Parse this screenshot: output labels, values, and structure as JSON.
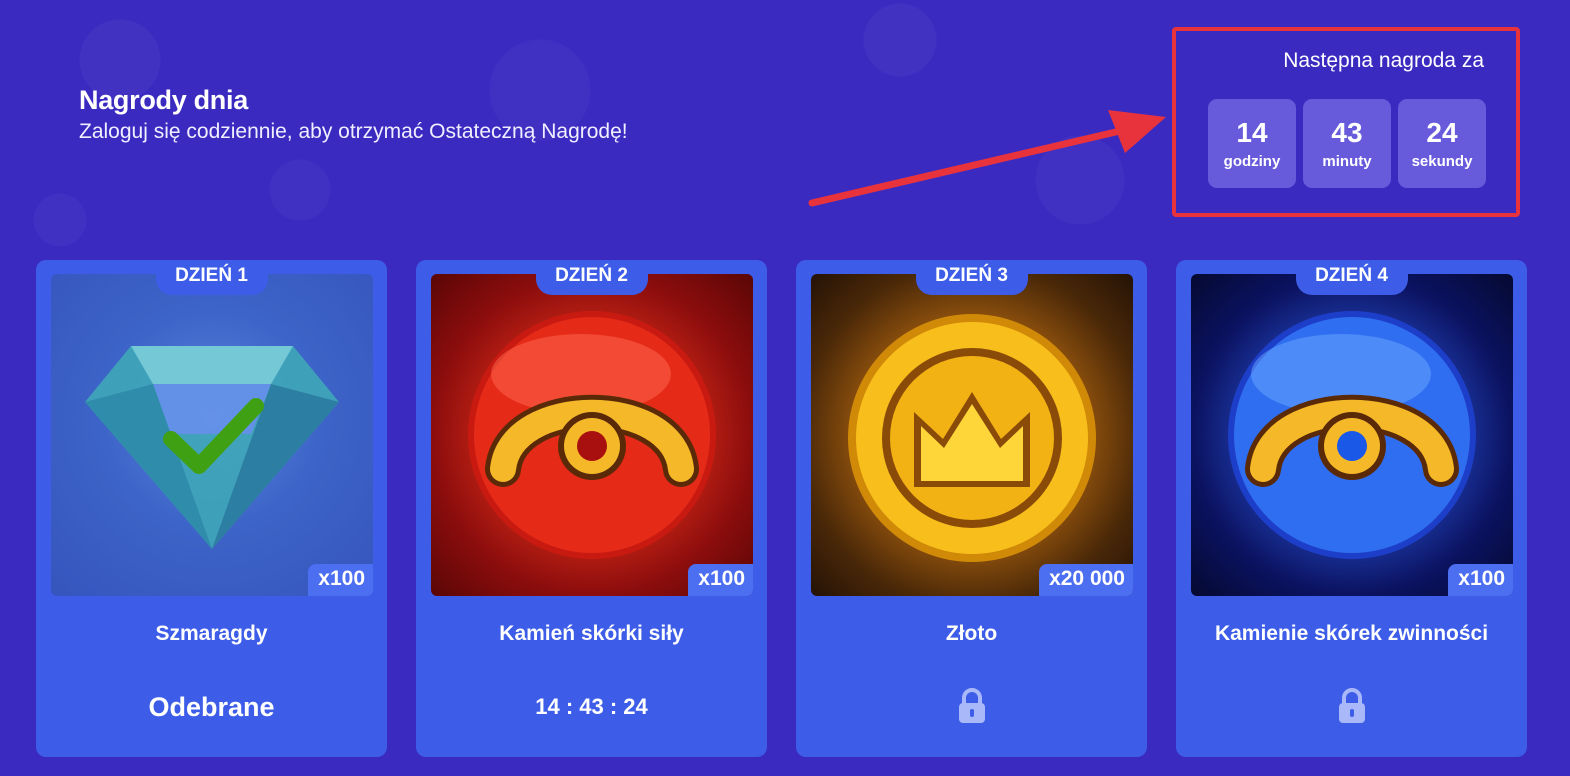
{
  "header": {
    "title": "Nagrody dnia",
    "subtitle": "Zaloguj się codziennie, aby otrzymać Ostateczną Nagrodę!"
  },
  "next_reward": {
    "title": "Następna nagroda za",
    "hours": "14",
    "hours_label": "godziny",
    "minutes": "43",
    "minutes_label": "minuty",
    "seconds": "24",
    "seconds_label": "sekundy"
  },
  "cards": [
    {
      "day": "DZIEŃ 1",
      "qty": "x100",
      "name": "Szmaragdy",
      "status": "Odebrane",
      "icon": "emerald-icon"
    },
    {
      "day": "DZIEŃ 2",
      "qty": "x100",
      "name": "Kamień skórki siły",
      "status": "14 : 43 : 24",
      "icon": "red-skin-stone-icon"
    },
    {
      "day": "DZIEŃ 3",
      "qty": "x20 000",
      "name": "Złoto",
      "status": "locked",
      "icon": "gold-coin-icon"
    },
    {
      "day": "DZIEŃ 4",
      "qty": "x100",
      "name": "Kamienie skórek zwinności",
      "status": "locked",
      "icon": "blue-skin-stone-icon"
    }
  ],
  "colors": {
    "background": "#3a2ac0",
    "card": "#3d5de8",
    "highlight_border": "#e8333c",
    "check": "#3fa014"
  }
}
